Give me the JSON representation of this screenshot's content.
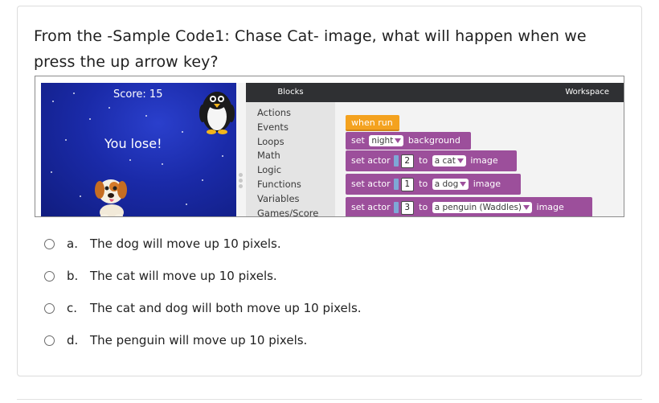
{
  "question": {
    "text": "From the -Sample Code1: Chase Cat- image, what will happen when we press the up arrow key?"
  },
  "figure": {
    "stage": {
      "score": "Score: 15",
      "status": "You lose!"
    },
    "blocks_panel": {
      "header": "Blocks",
      "items": [
        "Actions",
        "Events",
        "Loops",
        "Math",
        "Logic",
        "Functions",
        "Variables",
        "Games/Score"
      ]
    },
    "workspace": {
      "header": "Workspace",
      "when_run": "when run",
      "set_bg": {
        "prefix": "set",
        "value": "night",
        "suffix": "background"
      },
      "set_actors": [
        {
          "label": "set actor",
          "number": "2",
          "to": "to",
          "value": "a cat",
          "suffix": "image"
        },
        {
          "label": "set actor",
          "number": "1",
          "to": "to",
          "value": "a dog",
          "suffix": "image"
        },
        {
          "label": "set actor",
          "number": "3",
          "to": "to",
          "value": "a penguin (Waddles)",
          "suffix": "image"
        }
      ]
    }
  },
  "options": [
    {
      "letter": "a.",
      "text": "The dog will move up 10 pixels."
    },
    {
      "letter": "b.",
      "text": "The cat will move up 10 pixels."
    },
    {
      "letter": "c.",
      "text": "The cat and dog will both move up 10 pixels."
    },
    {
      "letter": "d.",
      "text": "The penguin will move up 10 pixels."
    }
  ],
  "colors": {
    "event_block": "#f4a21f",
    "actor_block": "#9c4f9b",
    "panel_header": "#2f3033",
    "stage_sky": "#1a2aa8"
  }
}
